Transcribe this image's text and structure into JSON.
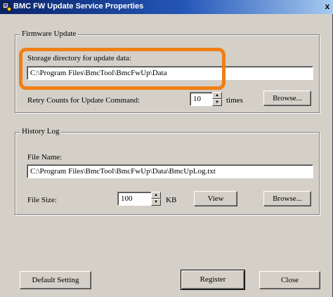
{
  "window": {
    "title": "BMC FW Update Service Properties",
    "icon": "gear-app-icon",
    "close_glyph": "x"
  },
  "firmware_update": {
    "legend": "Firmware Update",
    "storage_label": "Storage directory for update data:",
    "storage_value": "C:\\Program Files\\BmcTool\\BmcFwUp\\Data",
    "retry_label": "Retry Counts for Update Command:",
    "retry_value": "10",
    "retry_unit": "times",
    "browse_label": "Browse..."
  },
  "history_log": {
    "legend": "History Log",
    "file_name_label": "File Name:",
    "file_name_value": "C:\\Program Files\\BmcTool\\BmcFwUp\\Data\\BmcUpLog.txt",
    "file_size_label": "File Size:",
    "file_size_value": "100",
    "file_size_unit": "KB",
    "view_label": "View",
    "browse_label": "Browse..."
  },
  "footer": {
    "default_setting_label": "Default Setting",
    "register_label": "Register",
    "close_label": "Close"
  },
  "colors": {
    "highlight": "#f07f17",
    "title_bar": "#0a246a",
    "dialog_face": "#d4d0c8"
  }
}
